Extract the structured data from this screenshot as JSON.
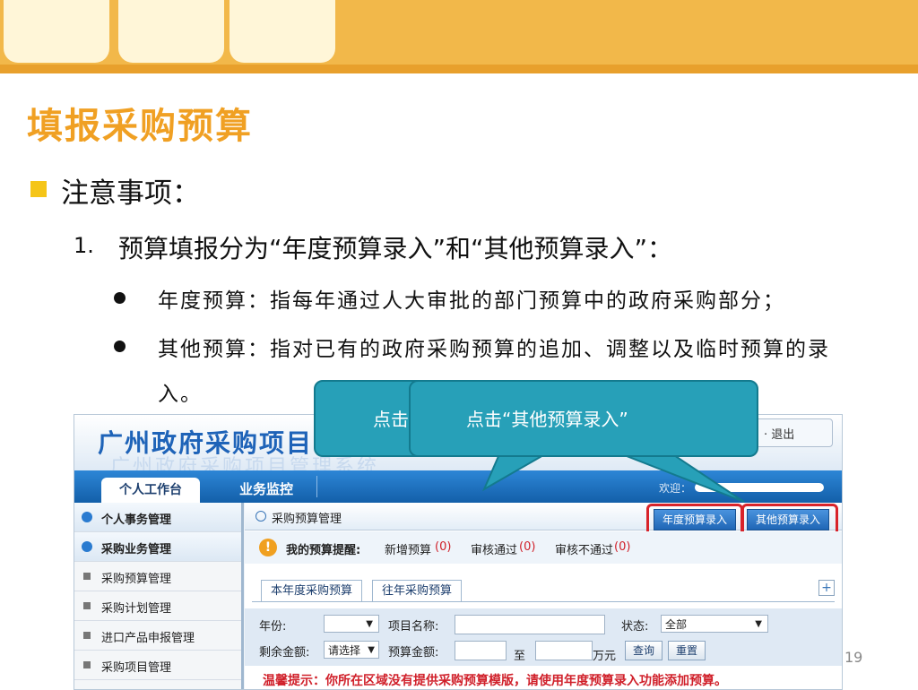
{
  "slide": {
    "title": "填报采购预算",
    "section_heading": "注意事项：",
    "item_number": "1.",
    "item_text": "预算填报分为“年度预算录入”和“其他预算录入”：",
    "bullets": [
      "年度预算：指每年通过人大审批的部门预算中的政府采购部分；",
      "其他预算：指对已有的政府采购预算的追加、调整以及临时预算的录",
      "入。"
    ],
    "page_number": "19",
    "callout_back_text": "点击",
    "callout_front_text": "点击“其他预算录入”",
    "colors": {
      "title": "#f0a023",
      "callout": "#27a0b8",
      "highlight": "#d8232a"
    }
  },
  "app": {
    "logo_text": "广州政府采购项目",
    "header_links": {
      "arrow": "↓",
      "logout": "· 退出"
    },
    "nav": {
      "tab_active": "个人工作台",
      "tab_other": "业务监控",
      "welcome": "欢迎："
    },
    "sidebar": [
      {
        "label": "个人事务管理",
        "icon": "cube-icon"
      },
      {
        "label": "采购业务管理",
        "icon": "cube-icon"
      },
      {
        "label": "采购预算管理",
        "icon": "square-bullet-icon"
      },
      {
        "label": "采购计划管理",
        "icon": "square-bullet-icon"
      },
      {
        "label": "进口产品申报管理",
        "icon": "square-bullet-icon"
      },
      {
        "label": "采购项目管理",
        "icon": "square-bullet-icon"
      }
    ],
    "panel_title": "采购预算管理",
    "buttons": {
      "annual": "年度预算录入",
      "other": "其他预算录入"
    },
    "reminder": {
      "label": "我的预算提醒:",
      "new_label": "新增预算",
      "new_count": "(0)",
      "approved_label": "审核通过",
      "approved_count": "(0)",
      "rejected_label": "审核不通过",
      "rejected_count": "(0)"
    },
    "tabs": [
      "本年度采购预算",
      "往年采购预算"
    ],
    "plus": "+",
    "filters": {
      "year_label": "年份:",
      "year_value": "",
      "name_label": "项目名称:",
      "status_label": "状态:",
      "status_value": "全部",
      "remaining_label": "剩余金额:",
      "remaining_value": "请选择",
      "amount_label": "预算金额:",
      "to": "至",
      "unit": "万元",
      "query": "查询",
      "reset": "重置"
    },
    "tip_text": "温馨提示：你所在区域没有提供采购预算模版，请使用年度预算录入功能添加预算。"
  }
}
